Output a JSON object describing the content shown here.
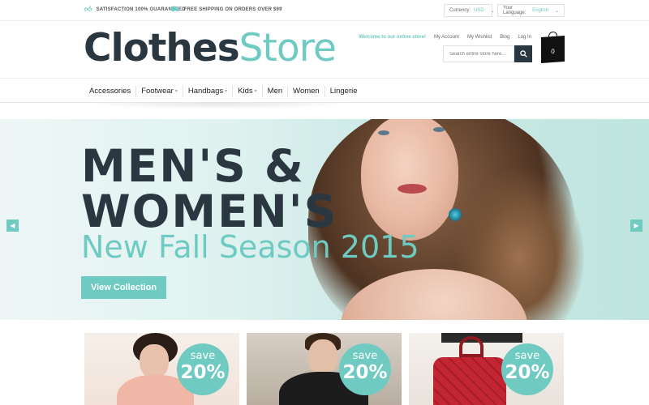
{
  "topbar": {
    "promo1": "SATISFACTION 100% GUARANTEED",
    "promo2": "FREE SHIPPING ON ORDERS OVER $99",
    "currency_label": "Currency:",
    "currency_value": "USD",
    "language_label": "Your Language:",
    "language_value": "English"
  },
  "header": {
    "logo_part1": "Clothes",
    "logo_part2": "Store",
    "welcome": "Welcome to our online store!",
    "links": [
      "My Account",
      "My Wishlist",
      "Blog",
      "Log In"
    ],
    "search_placeholder": "Search entire store here...",
    "cart_count": "0"
  },
  "nav": {
    "items": [
      {
        "label": "Accessories",
        "has_dropdown": false
      },
      {
        "label": "Footwear",
        "has_dropdown": true
      },
      {
        "label": "Handbags",
        "has_dropdown": true
      },
      {
        "label": "Kids",
        "has_dropdown": true
      },
      {
        "label": "Men",
        "has_dropdown": false
      },
      {
        "label": "Women",
        "has_dropdown": false
      },
      {
        "label": "Lingerie",
        "has_dropdown": false
      }
    ]
  },
  "hero": {
    "line1": "MEN'S &",
    "line2": "WOMEN'S",
    "subtitle": "New Fall Season 2015",
    "cta": "View Collection",
    "prev_icon": "chevron-left-icon",
    "next_icon": "chevron-right-icon"
  },
  "promos": [
    {
      "save": "save",
      "percent": "20%"
    },
    {
      "save": "save",
      "percent": "20%"
    },
    {
      "save": "save",
      "percent": "20%"
    }
  ],
  "colors": {
    "accent": "#6fcbc2",
    "dark": "#2b3740"
  }
}
